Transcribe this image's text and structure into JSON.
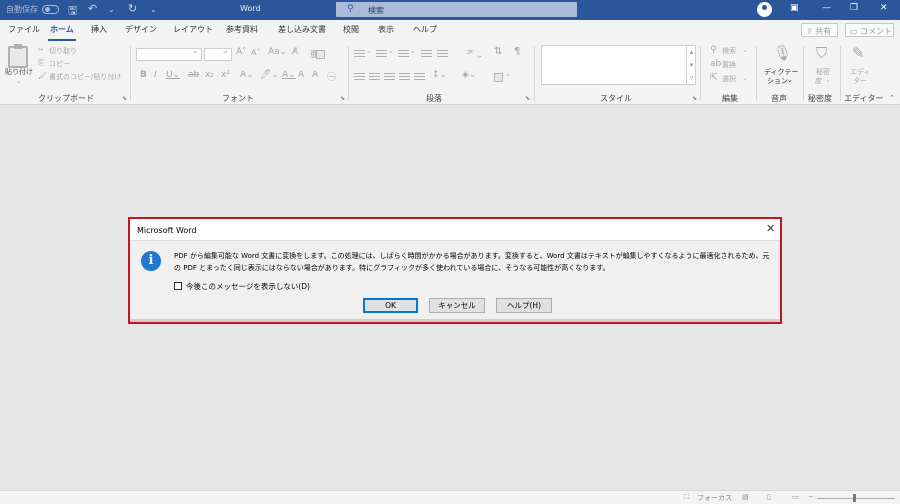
{
  "titlebar": {
    "autosave_label": "自動保存",
    "window_title": "Word",
    "search_placeholder": "検索"
  },
  "tabs": [
    "ファイル",
    "ホーム",
    "挿入",
    "デザイン",
    "レイアウト",
    "参考資料",
    "差し込み文書",
    "校閲",
    "表示",
    "ヘルプ"
  ],
  "active_tab": "ホーム",
  "share_label": "共有",
  "comment_label": "コメント",
  "ribbon": {
    "clipboard": {
      "paste_label": "貼り付け",
      "cut_label": "切り取り",
      "copy_label": "コピー",
      "format_painter_label": "書式のコピー/貼り付け",
      "group_label": "クリップボード"
    },
    "font_group_label": "フォント",
    "paragraph_group_label": "段落",
    "style_group_label": "スタイル",
    "editing": {
      "find_label": "検索",
      "replace_label": "置換",
      "select_label": "選択",
      "group_label": "編集"
    },
    "voice": {
      "dictate_label_line1": "ディクテー",
      "dictate_label_line2": "ション",
      "group_label": "音声"
    },
    "sensitivity": {
      "label_line1": "秘密",
      "label_line2": "度",
      "group_label": "秘密度"
    },
    "editor": {
      "label_line1": "エディ",
      "label_line2": "ター",
      "group_label": "エディター"
    }
  },
  "dialog": {
    "title": "Microsoft Word",
    "message": "PDF から編集可能な Word 文書に変換をします。この処理には、しばらく時間がかかる場合があります。変換すると、Word 文書はテキストが編集しやすくなるように最適化されるため、元の PDF とまったく同じ表示にはならない場合があります。特にグラフィックが多く使われている場合に、そうなる可能性が高くなります。",
    "checkbox_label": "今後このメッセージを表示しない(D)",
    "ok_label": "OK",
    "cancel_label": "キャンセル",
    "help_label": "ヘルプ(H)"
  },
  "statusbar": {
    "focus_label": "フォーカス"
  }
}
